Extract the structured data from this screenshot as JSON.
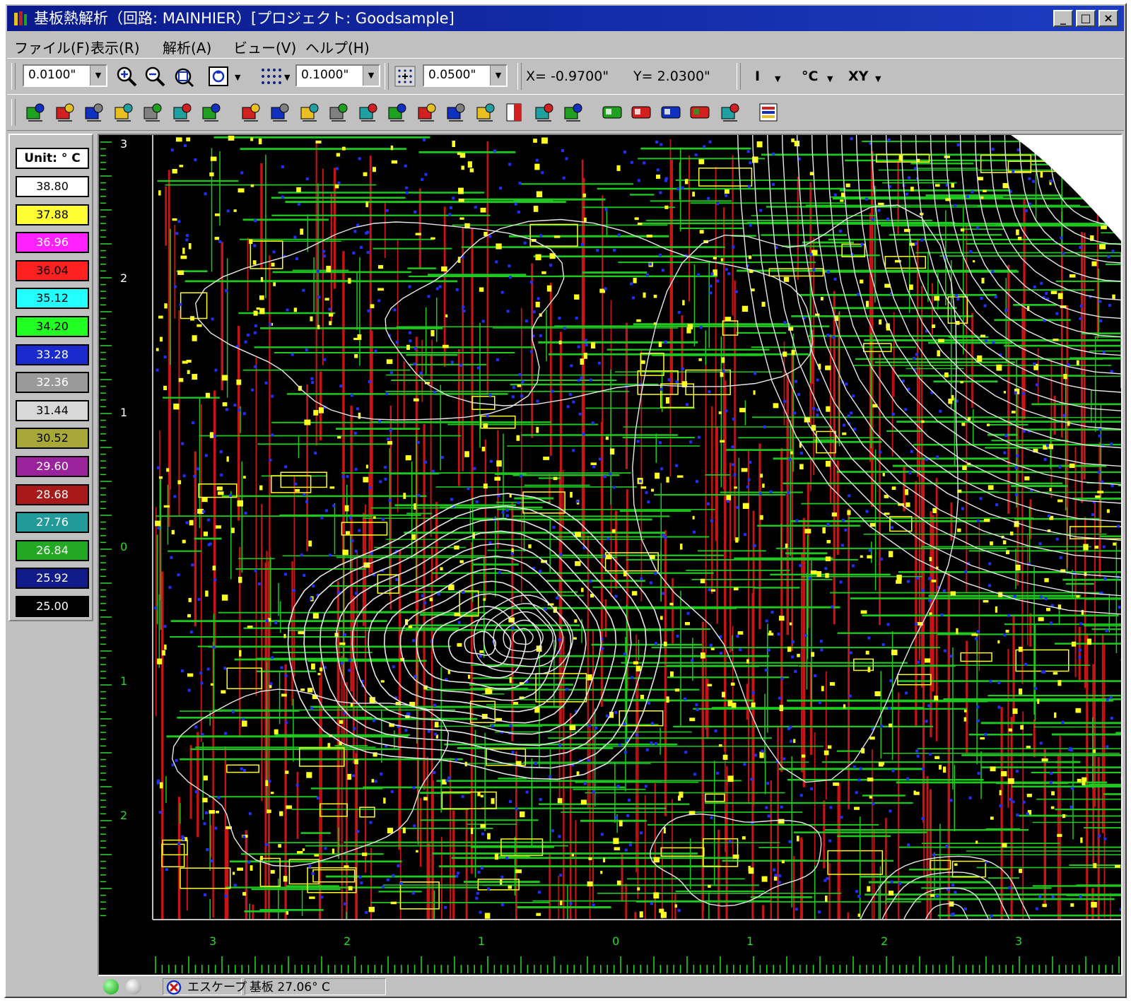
{
  "window": {
    "title": "基板熱解析（回路: MAINHIER）[プロジェクト: Goodsample]",
    "controls": {
      "minimize": "_",
      "maximize": "□",
      "close": "×"
    }
  },
  "menu": [
    {
      "label": "ファイル(F)"
    },
    {
      "label": "表示(R)"
    },
    {
      "label": "解析(A)"
    },
    {
      "label": "ビュー(V)"
    },
    {
      "label": "ヘルプ(H)"
    }
  ],
  "toolbar1": {
    "zoom_step": "0.0100\"",
    "grid_step": "0.1000\"",
    "snap_step": "0.0500\"",
    "x_coord": "X= -0.9700\"",
    "y_coord": "Y= 2.0300\"",
    "unit_length": "I",
    "unit_temp": "°C",
    "plane": "XY",
    "icons": [
      "zoom-in-icon",
      "zoom-out-icon",
      "zoom-window-icon",
      "zoom-fit-icon",
      "grid-dots-icon",
      "snap-grid-icon"
    ]
  },
  "toolbar2": {
    "icons": [
      "component-icon",
      "board-icon",
      "thermometer-icon",
      "heatsink-icon",
      "palette-icon",
      "fan-icon",
      "leaf-icon",
      "layers-icon",
      "place-icon",
      "target-icon",
      "grid-icon",
      "move-icon",
      "pick-icon",
      "report-icon",
      "mirror-icon",
      "measure-icon",
      "contrast-icon",
      "select-group-icon",
      "select-icon",
      "green-display-icon",
      "red-display-icon",
      "mixed-display-icon",
      "red-green-display-icon",
      "snapshot-icon",
      "stack-icon"
    ]
  },
  "legend": {
    "unit": "Unit: ° C",
    "levels": [
      {
        "value": "38.80",
        "color": "#ffffff",
        "text": "#000000"
      },
      {
        "value": "37.88",
        "color": "#ffff33",
        "text": "#000000"
      },
      {
        "value": "36.96",
        "color": "#ff22ff",
        "text": "#ffffff"
      },
      {
        "value": "36.04",
        "color": "#ff2020",
        "text": "#000000"
      },
      {
        "value": "35.12",
        "color": "#22ffff",
        "text": "#000000"
      },
      {
        "value": "34.20",
        "color": "#22ff22",
        "text": "#000000"
      },
      {
        "value": "33.28",
        "color": "#1a2acc",
        "text": "#ffffff"
      },
      {
        "value": "32.36",
        "color": "#9a9a9a",
        "text": "#ffffff"
      },
      {
        "value": "31.44",
        "color": "#d8d8d8",
        "text": "#000000"
      },
      {
        "value": "30.52",
        "color": "#a8a838",
        "text": "#000000"
      },
      {
        "value": "29.60",
        "color": "#9a229a",
        "text": "#ffffff"
      },
      {
        "value": "28.68",
        "color": "#a81a1a",
        "text": "#ffffff"
      },
      {
        "value": "27.76",
        "color": "#229a9a",
        "text": "#ffffff"
      },
      {
        "value": "26.84",
        "color": "#22a822",
        "text": "#ffffff"
      },
      {
        "value": "25.92",
        "color": "#101a88",
        "text": "#ffffff"
      },
      {
        "value": "25.00",
        "color": "#000000",
        "text": "#ffffff"
      }
    ]
  },
  "rulers": {
    "vertical": [
      "3",
      "2",
      "1",
      "0",
      "1",
      "2"
    ],
    "horizontal": [
      "3",
      "2",
      "1",
      "0",
      "1",
      "2",
      "3"
    ]
  },
  "status": {
    "escape": "エスケープ",
    "board_temp": "基板 27.06° C"
  },
  "colors": {
    "trace_green": "#1ec81e",
    "trace_red": "#c81414",
    "pad_yellow": "#ffff22",
    "via_blue": "#2030ff",
    "contour_white": "#e8e8e8",
    "ruler_green": "#22dd22"
  }
}
